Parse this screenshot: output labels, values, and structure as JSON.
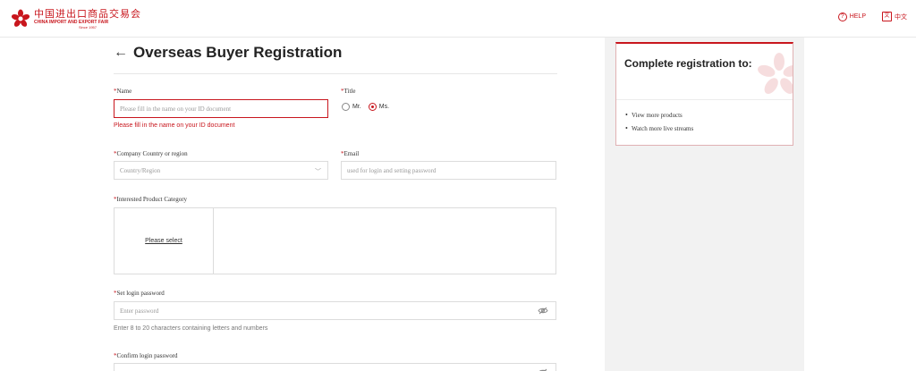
{
  "header": {
    "logo_cn": "中国进出口商品交易会",
    "logo_en": "CHINA IMPORT AND EXPORT FAIR",
    "logo_since": "Since 1957",
    "help_label": "HELP",
    "lang_label": "中文",
    "brand_color": "#c8161d"
  },
  "form": {
    "back_icon": "arrow-left-icon",
    "title": "Overseas Buyer Registration",
    "required_mark": "*",
    "name": {
      "label": "Name",
      "placeholder": "Please fill in the name on your ID document",
      "error": "Please fill in the name on your ID document"
    },
    "title_field": {
      "label": "Title",
      "options": [
        "Mr.",
        "Ms."
      ],
      "selected": "Ms."
    },
    "country": {
      "label": "Company Country or region",
      "placeholder": "Country/Region"
    },
    "email": {
      "label": "Email",
      "placeholder": "used for login and setting password"
    },
    "category": {
      "label": "Interested Product Category",
      "select_label": "Please select"
    },
    "password": {
      "label": "Set login password",
      "placeholder": "Enter password",
      "hint": "Enter 8 to 20 characters containing letters and numbers"
    },
    "confirm_password": {
      "label": "Confirm login password"
    }
  },
  "sidebar": {
    "card_title": "Complete registration to:",
    "benefits": [
      "View more products",
      "Watch more live streams"
    ]
  }
}
